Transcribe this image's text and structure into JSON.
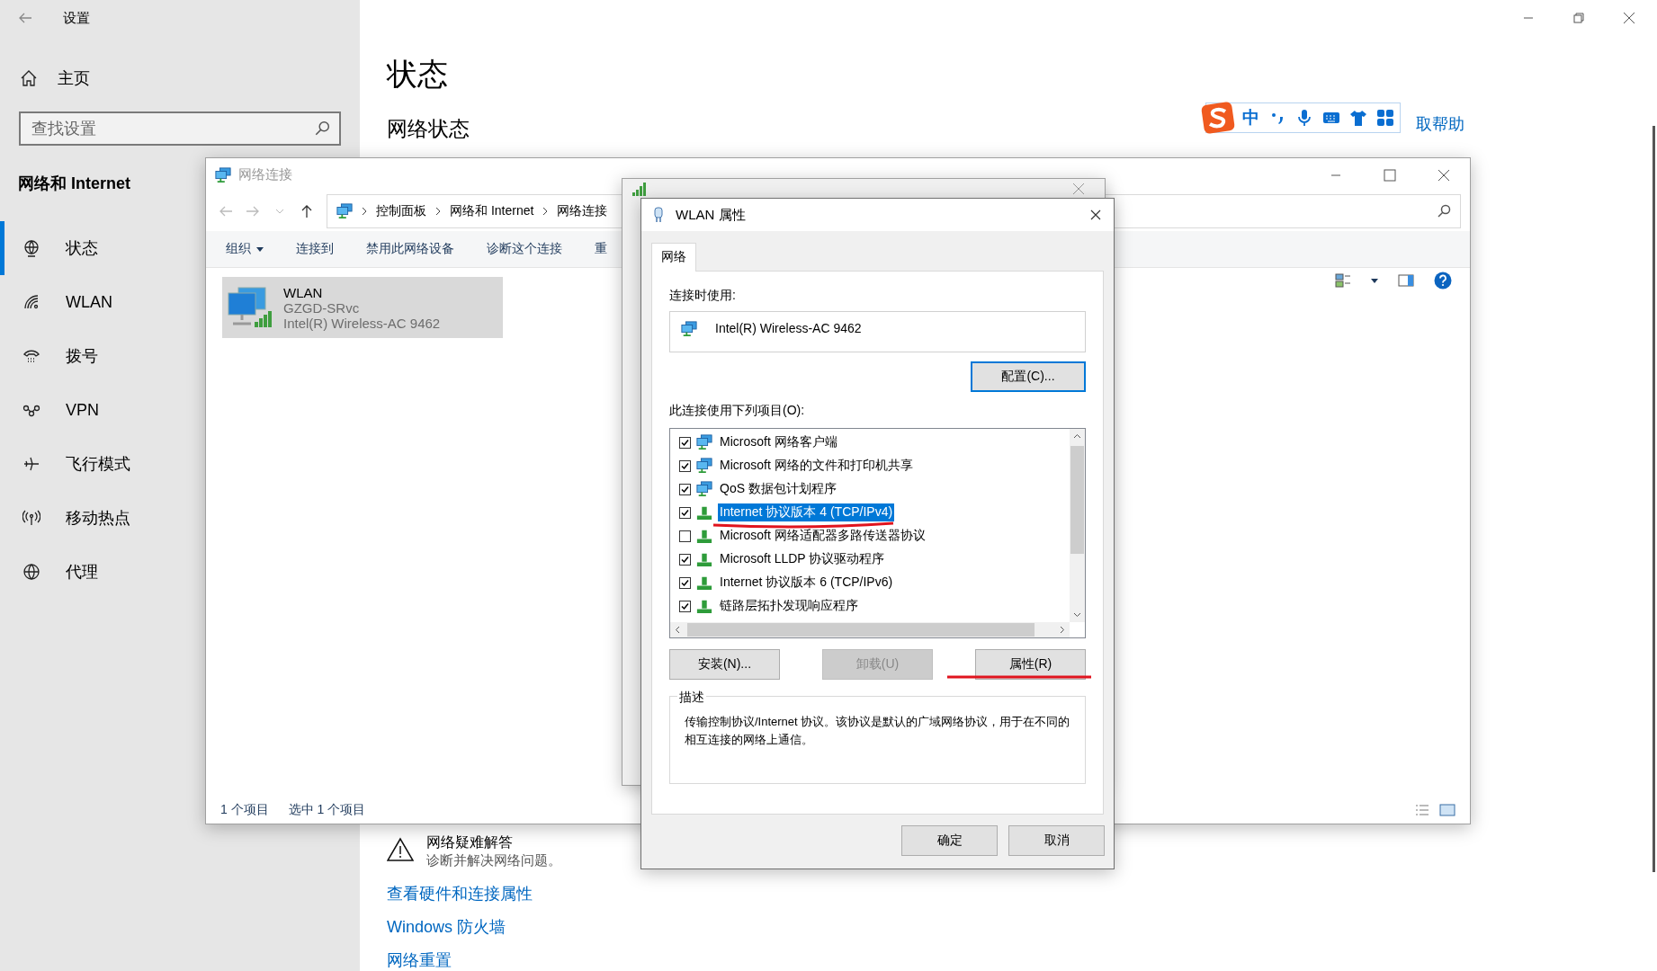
{
  "settings": {
    "title": "设置",
    "home": "主页",
    "search": {
      "placeholder": "查找设置"
    },
    "section": "网络和 Internet",
    "nav": [
      {
        "label": "状态",
        "kind": "status",
        "selected": true
      },
      {
        "label": "WLAN",
        "kind": "wifi",
        "selected": false
      },
      {
        "label": "拨号",
        "kind": "dialup",
        "selected": false
      },
      {
        "label": "VPN",
        "kind": "vpn",
        "selected": false
      },
      {
        "label": "飞行模式",
        "kind": "airplane",
        "selected": false
      },
      {
        "label": "移动热点",
        "kind": "hotspot",
        "selected": false
      },
      {
        "label": "代理",
        "kind": "proxy",
        "selected": false
      }
    ]
  },
  "main": {
    "heading": "状态",
    "subheading": "网络状态",
    "help_link": "取帮助",
    "troubleshooter": {
      "title": "网络疑难解答",
      "subtitle": "诊断并解决网络问题。"
    },
    "links": [
      "查看硬件和连接属性",
      "Windows 防火墙",
      "网络重置"
    ]
  },
  "ime_toolbar": {
    "mode": "中"
  },
  "network_connections": {
    "title": "网络连接",
    "breadcrumb": [
      "控制面板",
      "网络和 Internet",
      "网络连接"
    ],
    "toolbar": [
      {
        "label": "组织",
        "dropdown": true
      },
      {
        "label": "连接到",
        "dropdown": false
      },
      {
        "label": "禁用此网络设备",
        "dropdown": false
      },
      {
        "label": "诊断这个连接",
        "dropdown": false
      },
      {
        "label": "重",
        "dropdown": false
      }
    ],
    "items": [
      {
        "name": "WLAN",
        "network": "GZGD-SRvc",
        "adapter": "Intel(R) Wireless-AC 9462",
        "selected": true
      }
    ],
    "status_bar": [
      "1 个项目",
      "选中 1 个项目"
    ]
  },
  "wlan_properties": {
    "title": "WLAN 属性",
    "tabs": [
      {
        "label": "网络",
        "selected": true
      }
    ],
    "connect_using_label": "连接时使用:",
    "adapter": "Intel(R) Wireless-AC 9462",
    "configure_button": "配置(C)...",
    "items_label": "此连接使用下列项目(O):",
    "components": [
      {
        "label": "Microsoft 网络客户端",
        "kind": "client",
        "checked": true,
        "selected": false
      },
      {
        "label": "Microsoft 网络的文件和打印机共享",
        "kind": "client",
        "checked": true,
        "selected": false
      },
      {
        "label": "QoS 数据包计划程序",
        "kind": "client",
        "checked": true,
        "selected": false
      },
      {
        "label": "Internet 协议版本 4 (TCP/IPv4)",
        "kind": "protocol",
        "checked": true,
        "selected": true
      },
      {
        "label": "Microsoft 网络适配器多路传送器协议",
        "kind": "protocol",
        "checked": false,
        "selected": false
      },
      {
        "label": "Microsoft LLDP 协议驱动程序",
        "kind": "protocol",
        "checked": true,
        "selected": false
      },
      {
        "label": "Internet 协议版本 6 (TCP/IPv6)",
        "kind": "protocol",
        "checked": true,
        "selected": false
      },
      {
        "label": "链路层拓扑发现响应程序",
        "kind": "protocol",
        "checked": true,
        "selected": false
      }
    ],
    "buttons": [
      {
        "label": "安装(N)...",
        "disabled": false
      },
      {
        "label": "卸载(U)",
        "disabled": true
      },
      {
        "label": "属性(R)",
        "disabled": false
      }
    ],
    "description_label": "描述",
    "description": "传输控制协议/Internet 协议。该协议是默认的广域网络协议，用于在不同的相互连接的网络上通信。",
    "dialog_buttons": [
      "确定",
      "取消"
    ]
  }
}
